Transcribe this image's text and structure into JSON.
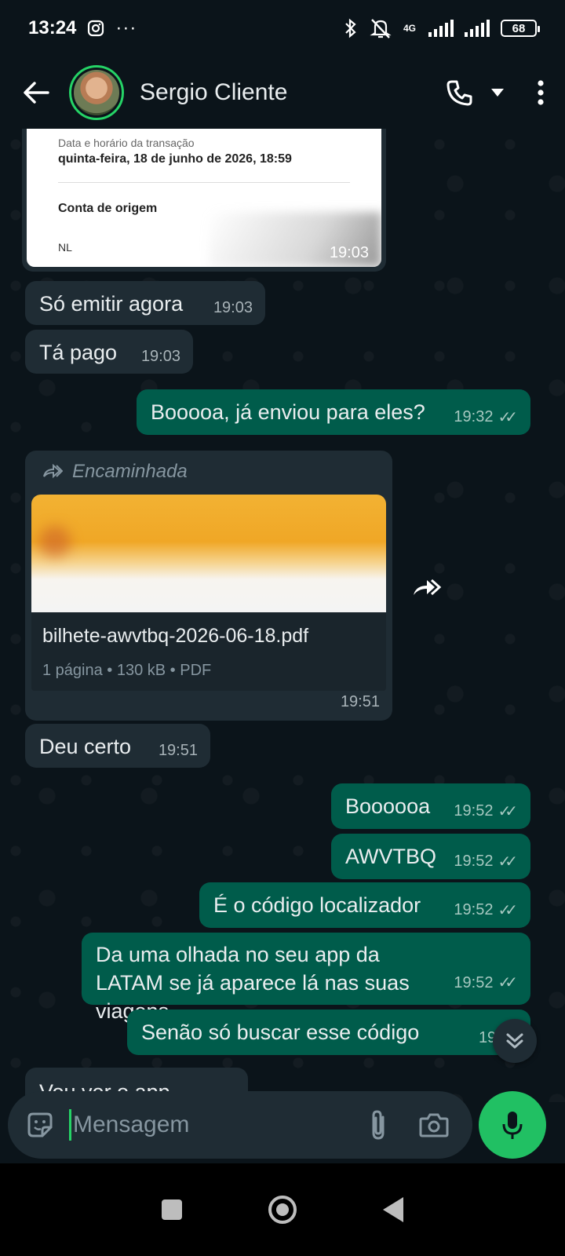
{
  "status_bar": {
    "time": "13:24",
    "network_label": "4G",
    "battery": "68"
  },
  "header": {
    "contact_name": "Sergio Cliente"
  },
  "receipt": {
    "label": "Data e horário da transação",
    "date": "quinta-feira, 18 de junho de 2026, 18:59",
    "account_label": "Conta de origem",
    "initials": "NL",
    "time": "19:03"
  },
  "messages": [
    {
      "text": "Só emitir agora",
      "time": "19:03",
      "dir": "in"
    },
    {
      "text": "Tá pago",
      "time": "19:03",
      "dir": "in"
    },
    {
      "text": "Booooa, já enviou para eles?",
      "time": "19:32",
      "dir": "out"
    },
    {
      "text": "Deu certo",
      "time": "19:51",
      "dir": "in"
    },
    {
      "text": "Boooooa",
      "time": "19:52",
      "dir": "out"
    },
    {
      "text": "AWVTBQ",
      "time": "19:52",
      "dir": "out"
    },
    {
      "text": "É o código localizador",
      "time": "19:52",
      "dir": "out"
    },
    {
      "text": "Da uma olhada no seu app da LATAM se já aparece lá nas suas viagens",
      "time": "19:52",
      "dir": "out"
    },
    {
      "text": "Senão só buscar esse código",
      "time": "19:52",
      "dir": "out"
    },
    {
      "text": "Vou ver o app",
      "time": "",
      "dir": "in"
    }
  ],
  "document": {
    "forwarded_label": "Encaminhada",
    "file_name": "bilhete-awvtbq-2026-06-18.pdf",
    "details": "1 página • 130 kB • PDF",
    "time": "19:51"
  },
  "input": {
    "placeholder": "Mensagem"
  },
  "colors": {
    "background": "#0b141a",
    "incoming": "#1f2c34",
    "outgoing": "#005c4b",
    "accent": "#21c063"
  }
}
